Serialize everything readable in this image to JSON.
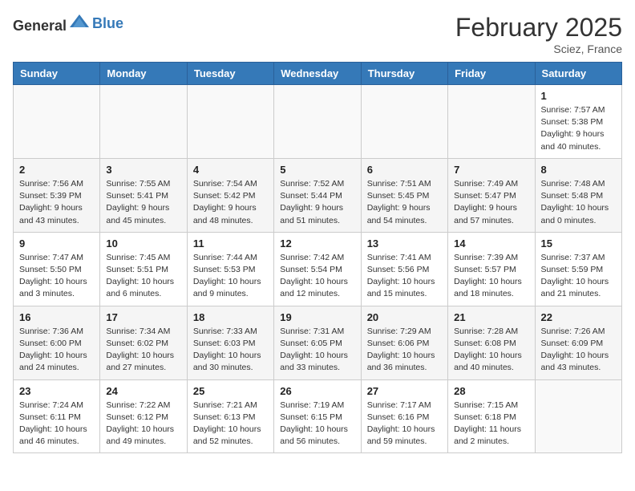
{
  "header": {
    "logo_general": "General",
    "logo_blue": "Blue",
    "month_title": "February 2025",
    "subtitle": "Sciez, France"
  },
  "weekdays": [
    "Sunday",
    "Monday",
    "Tuesday",
    "Wednesday",
    "Thursday",
    "Friday",
    "Saturday"
  ],
  "weeks": [
    [
      {
        "day": "",
        "info": ""
      },
      {
        "day": "",
        "info": ""
      },
      {
        "day": "",
        "info": ""
      },
      {
        "day": "",
        "info": ""
      },
      {
        "day": "",
        "info": ""
      },
      {
        "day": "",
        "info": ""
      },
      {
        "day": "1",
        "info": "Sunrise: 7:57 AM\nSunset: 5:38 PM\nDaylight: 9 hours and 40 minutes."
      }
    ],
    [
      {
        "day": "2",
        "info": "Sunrise: 7:56 AM\nSunset: 5:39 PM\nDaylight: 9 hours and 43 minutes."
      },
      {
        "day": "3",
        "info": "Sunrise: 7:55 AM\nSunset: 5:41 PM\nDaylight: 9 hours and 45 minutes."
      },
      {
        "day": "4",
        "info": "Sunrise: 7:54 AM\nSunset: 5:42 PM\nDaylight: 9 hours and 48 minutes."
      },
      {
        "day": "5",
        "info": "Sunrise: 7:52 AM\nSunset: 5:44 PM\nDaylight: 9 hours and 51 minutes."
      },
      {
        "day": "6",
        "info": "Sunrise: 7:51 AM\nSunset: 5:45 PM\nDaylight: 9 hours and 54 minutes."
      },
      {
        "day": "7",
        "info": "Sunrise: 7:49 AM\nSunset: 5:47 PM\nDaylight: 9 hours and 57 minutes."
      },
      {
        "day": "8",
        "info": "Sunrise: 7:48 AM\nSunset: 5:48 PM\nDaylight: 10 hours and 0 minutes."
      }
    ],
    [
      {
        "day": "9",
        "info": "Sunrise: 7:47 AM\nSunset: 5:50 PM\nDaylight: 10 hours and 3 minutes."
      },
      {
        "day": "10",
        "info": "Sunrise: 7:45 AM\nSunset: 5:51 PM\nDaylight: 10 hours and 6 minutes."
      },
      {
        "day": "11",
        "info": "Sunrise: 7:44 AM\nSunset: 5:53 PM\nDaylight: 10 hours and 9 minutes."
      },
      {
        "day": "12",
        "info": "Sunrise: 7:42 AM\nSunset: 5:54 PM\nDaylight: 10 hours and 12 minutes."
      },
      {
        "day": "13",
        "info": "Sunrise: 7:41 AM\nSunset: 5:56 PM\nDaylight: 10 hours and 15 minutes."
      },
      {
        "day": "14",
        "info": "Sunrise: 7:39 AM\nSunset: 5:57 PM\nDaylight: 10 hours and 18 minutes."
      },
      {
        "day": "15",
        "info": "Sunrise: 7:37 AM\nSunset: 5:59 PM\nDaylight: 10 hours and 21 minutes."
      }
    ],
    [
      {
        "day": "16",
        "info": "Sunrise: 7:36 AM\nSunset: 6:00 PM\nDaylight: 10 hours and 24 minutes."
      },
      {
        "day": "17",
        "info": "Sunrise: 7:34 AM\nSunset: 6:02 PM\nDaylight: 10 hours and 27 minutes."
      },
      {
        "day": "18",
        "info": "Sunrise: 7:33 AM\nSunset: 6:03 PM\nDaylight: 10 hours and 30 minutes."
      },
      {
        "day": "19",
        "info": "Sunrise: 7:31 AM\nSunset: 6:05 PM\nDaylight: 10 hours and 33 minutes."
      },
      {
        "day": "20",
        "info": "Sunrise: 7:29 AM\nSunset: 6:06 PM\nDaylight: 10 hours and 36 minutes."
      },
      {
        "day": "21",
        "info": "Sunrise: 7:28 AM\nSunset: 6:08 PM\nDaylight: 10 hours and 40 minutes."
      },
      {
        "day": "22",
        "info": "Sunrise: 7:26 AM\nSunset: 6:09 PM\nDaylight: 10 hours and 43 minutes."
      }
    ],
    [
      {
        "day": "23",
        "info": "Sunrise: 7:24 AM\nSunset: 6:11 PM\nDaylight: 10 hours and 46 minutes."
      },
      {
        "day": "24",
        "info": "Sunrise: 7:22 AM\nSunset: 6:12 PM\nDaylight: 10 hours and 49 minutes."
      },
      {
        "day": "25",
        "info": "Sunrise: 7:21 AM\nSunset: 6:13 PM\nDaylight: 10 hours and 52 minutes."
      },
      {
        "day": "26",
        "info": "Sunrise: 7:19 AM\nSunset: 6:15 PM\nDaylight: 10 hours and 56 minutes."
      },
      {
        "day": "27",
        "info": "Sunrise: 7:17 AM\nSunset: 6:16 PM\nDaylight: 10 hours and 59 minutes."
      },
      {
        "day": "28",
        "info": "Sunrise: 7:15 AM\nSunset: 6:18 PM\nDaylight: 11 hours and 2 minutes."
      },
      {
        "day": "",
        "info": ""
      }
    ]
  ]
}
